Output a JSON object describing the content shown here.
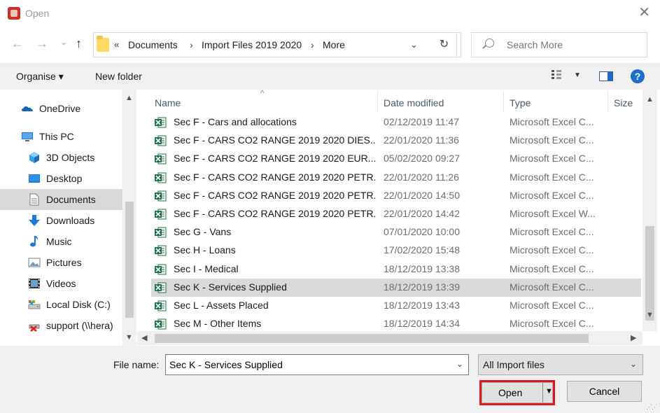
{
  "window": {
    "title": "Open",
    "close_glyph": "✕"
  },
  "nav": {
    "back_glyph": "←",
    "forward_glyph": "→",
    "recent_glyph": "⌄",
    "up_glyph": "↑",
    "breadcrumb_overflow": "«",
    "breadcrumbs": [
      "Documents",
      "Import Files 2019 2020",
      "More"
    ],
    "separator": "›",
    "dropdown_glyph": "⌄",
    "refresh_glyph": "↻",
    "search_placeholder": "Search More"
  },
  "toolbar": {
    "organise_label": "Organise ▾",
    "new_folder_label": "New folder",
    "view_caret": "▼",
    "help_label": "?"
  },
  "sidebar": {
    "items": [
      {
        "label": "OneDrive",
        "icon": "onedrive-icon"
      },
      {
        "label": "This PC",
        "icon": "this-pc-icon"
      },
      {
        "label": "3D Objects",
        "icon": "3d-objects-icon"
      },
      {
        "label": "Desktop",
        "icon": "desktop-icon"
      },
      {
        "label": "Documents",
        "icon": "documents-icon",
        "selected": true
      },
      {
        "label": "Downloads",
        "icon": "downloads-icon"
      },
      {
        "label": "Music",
        "icon": "music-icon"
      },
      {
        "label": "Pictures",
        "icon": "pictures-icon"
      },
      {
        "label": "Videos",
        "icon": "videos-icon"
      },
      {
        "label": "Local Disk (C:)",
        "icon": "local-disk-icon"
      },
      {
        "label": "support (\\\\hera)",
        "icon": "network-drive-disconnected-icon"
      }
    ]
  },
  "file_list": {
    "columns": {
      "name": "Name",
      "date": "Date modified",
      "type": "Type",
      "size": "Size"
    },
    "sort_glyph": "^",
    "rows": [
      {
        "name": "Sec F - Cars and allocations",
        "date": "02/12/2019 11:47",
        "type": "Microsoft Excel C..."
      },
      {
        "name": "Sec F - CARS CO2 RANGE 2019 2020 DIES...",
        "date": "22/01/2020 11:36",
        "type": "Microsoft Excel C..."
      },
      {
        "name": "Sec F - CARS CO2 RANGE 2019 2020 EUR...",
        "date": "05/02/2020 09:27",
        "type": "Microsoft Excel C..."
      },
      {
        "name": "Sec F - CARS CO2 RANGE 2019 2020 PETR...",
        "date": "22/01/2020 11:26",
        "type": "Microsoft Excel C..."
      },
      {
        "name": "Sec F - CARS CO2 RANGE 2019 2020 PETR...",
        "date": "22/01/2020 14:50",
        "type": "Microsoft Excel C..."
      },
      {
        "name": "Sec F - CARS CO2 RANGE 2019 2020 PETR...",
        "date": "22/01/2020 14:42",
        "type": "Microsoft Excel W..."
      },
      {
        "name": "Sec G - Vans",
        "date": "07/01/2020 10:00",
        "type": "Microsoft Excel C..."
      },
      {
        "name": "Sec H - Loans",
        "date": "17/02/2020 15:48",
        "type": "Microsoft Excel C..."
      },
      {
        "name": "Sec I - Medical",
        "date": "18/12/2019 13:38",
        "type": "Microsoft Excel C..."
      },
      {
        "name": "Sec K - Services Supplied",
        "date": "18/12/2019 13:39",
        "type": "Microsoft Excel C...",
        "selected": true
      },
      {
        "name": "Sec L - Assets Placed",
        "date": "18/12/2019 13:43",
        "type": "Microsoft Excel C..."
      },
      {
        "name": "Sec M - Other Items",
        "date": "18/12/2019 14:34",
        "type": "Microsoft Excel C..."
      }
    ]
  },
  "footer": {
    "file_name_label": "File name:",
    "file_name_value": "Sec K - Services Supplied",
    "filter_value": "All Import files",
    "open_label": "Open",
    "open_arrow": "▼",
    "cancel_label": "Cancel",
    "caret": "⌄"
  },
  "colors": {
    "accent": "#1a6fc8",
    "selection": "#d9d9d9",
    "highlight_border": "#e1161d",
    "excel_green": "#1d7044"
  }
}
